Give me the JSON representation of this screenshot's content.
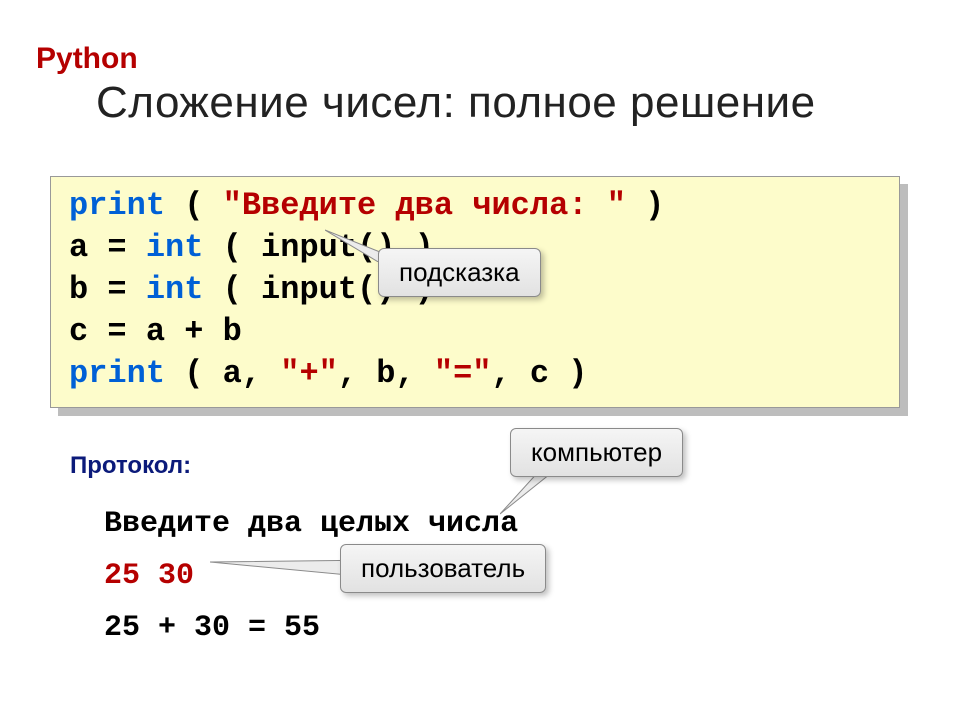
{
  "header": "Python",
  "title": "Сложение чисел: полное решение",
  "code": {
    "l1_kw": "print",
    "l1_rest_a": " ( ",
    "l1_str": "\"Введите два числа: \"",
    "l1_rest_b": " )",
    "l2_a": "a = ",
    "l2_kw": "int",
    "l2_b": " ( input() )",
    "l3_a": "b = ",
    "l3_kw": "int",
    "l3_b": " ( input() )",
    "l4": "c = a + b",
    "l5_kw": "print",
    "l5_a": " ( a, ",
    "l5_s1": "\"+\"",
    "l5_b": ", b, ",
    "l5_s2": "\"=\"",
    "l5_c": ", c )"
  },
  "callouts": {
    "hint": "подсказка",
    "computer": "компьютер",
    "user": "пользователь"
  },
  "protocol": {
    "label": "Протокол:",
    "line1": "Введите два целых числа",
    "line2": "25 30",
    "line3": "25 + 30 = 55"
  }
}
